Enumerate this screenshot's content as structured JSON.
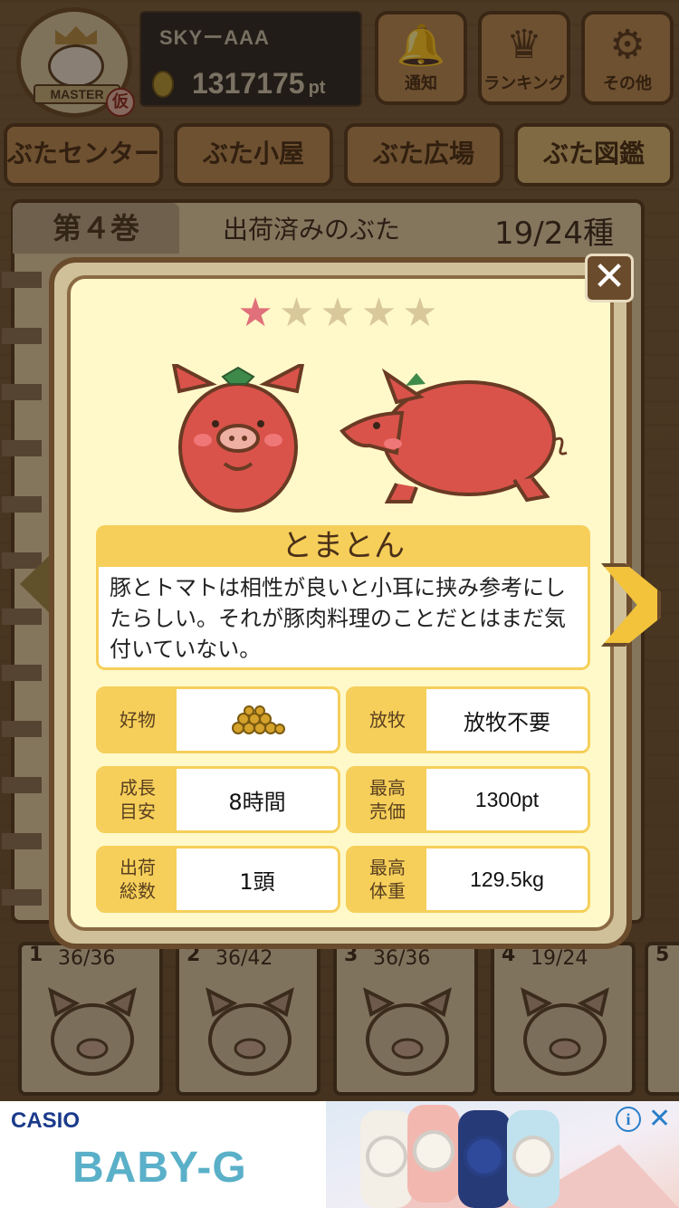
{
  "header": {
    "badge_text": "MASTER",
    "badge_kari": "仮",
    "username": "SKYーAAA",
    "points": "1317175",
    "points_unit": "pt",
    "buttons": [
      {
        "label": "通知",
        "icon": "bell-icon"
      },
      {
        "label": "ランキング",
        "icon": "crown-icon"
      },
      {
        "label": "その他",
        "icon": "gear-icon"
      }
    ]
  },
  "tabs": [
    {
      "label": "ぶたセンター"
    },
    {
      "label": "ぶた小屋"
    },
    {
      "label": "ぶた広場"
    },
    {
      "label": "ぶた図鑑",
      "active": true
    }
  ],
  "book": {
    "volume": "第４巻",
    "title": "出荷済みのぶた",
    "count": "19/24種"
  },
  "bottom_volumes": [
    {
      "num": "1",
      "count": "36/36"
    },
    {
      "num": "2",
      "count": "36/42"
    },
    {
      "num": "3",
      "count": "36/36"
    },
    {
      "num": "4",
      "count": "19/24"
    },
    {
      "num": "5",
      "count": ""
    }
  ],
  "modal": {
    "rating": 1,
    "rating_max": 5,
    "name": "とまとん",
    "description": "豚とトマトは相性が良いと小耳に挟み参考にしたらしい。それが豚肉料理のことだとはまだ気付いていない。",
    "stats": {
      "food_label": "好物",
      "food_icon": "feed-pellets-icon",
      "graze_label": "放牧",
      "graze_value": "放牧不要",
      "growth_label": "成長\n目安",
      "growth_value": "8時間",
      "max_price_label": "最高\n売価",
      "max_price_value": "1300pt",
      "shipped_label": "出荷\n総数",
      "shipped_value": "1頭",
      "max_weight_label": "最高\n体重",
      "max_weight_value": "129.5kg"
    },
    "colors": {
      "pig_red": "#d9534a",
      "accent_yellow": "#f6cf5a",
      "panel_bg": "#fff9c9"
    }
  },
  "ad": {
    "brand": "CASIO",
    "product": "BABY-G",
    "info_icon": "i",
    "close_icon": "✕"
  }
}
